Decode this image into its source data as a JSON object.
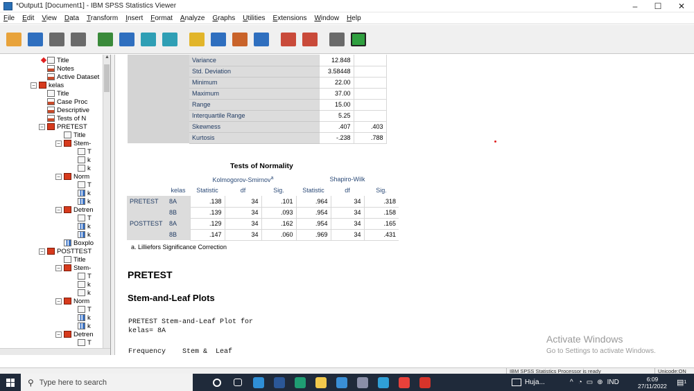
{
  "window": {
    "title": "*Output1 [Document1] - IBM SPSS Statistics Viewer",
    "controls": {
      "minimize": "–",
      "maximize": "☐",
      "close": "✕"
    }
  },
  "menu": [
    "File",
    "Edit",
    "View",
    "Data",
    "Transform",
    "Insert",
    "Format",
    "Analyze",
    "Graphs",
    "Utilities",
    "Extensions",
    "Window",
    "Help"
  ],
  "toolbar": {
    "icons": [
      "open-icon",
      "save-icon",
      "print-icon",
      "print-preview-icon",
      "export-icon",
      "recall-dialog-icon",
      "undo-icon",
      "redo-icon",
      "goto-data-icon",
      "goto-case-icon",
      "goto-variable-icon",
      "variables-icon",
      "show-all-icon",
      "designate-window-icon",
      "hide-icon",
      "show-icon"
    ],
    "colors": [
      "#e8a33b",
      "#2f6fbf",
      "#6a6a6a",
      "#6a6a6a",
      "#3a8a3a",
      "#2f6fbf",
      "#2f9fb5",
      "#2f9fb5",
      "#e2b52a",
      "#2f6fbf",
      "#c9632a",
      "#2f6fbf",
      "#c94a3a",
      "#c94a3a",
      "#6a6a6a",
      "#2f9f3f"
    ]
  },
  "tree": {
    "items": [
      {
        "label": "Title",
        "icon": "doc",
        "level": 4
      },
      {
        "label": "Notes",
        "icon": "tab",
        "level": 4
      },
      {
        "label": "Active Dataset",
        "icon": "tab",
        "level": 4
      },
      {
        "label": "kelas",
        "icon": "red",
        "level": 3
      },
      {
        "label": "Title",
        "icon": "doc",
        "level": 4
      },
      {
        "label": "Case Proc",
        "icon": "tab",
        "level": 4
      },
      {
        "label": "Descriptive",
        "icon": "tab",
        "level": 4
      },
      {
        "label": "Tests of N",
        "icon": "tab",
        "level": 4
      },
      {
        "label": "PRETEST",
        "icon": "red",
        "level": 4
      },
      {
        "label": "Title",
        "icon": "doc",
        "level": 5
      },
      {
        "label": "Stem-",
        "icon": "red",
        "level": 5
      },
      {
        "label": "T",
        "icon": "doc",
        "level": 6
      },
      {
        "label": "k",
        "icon": "doc",
        "level": 6
      },
      {
        "label": "k",
        "icon": "doc",
        "level": 6
      },
      {
        "label": "Norm",
        "icon": "red",
        "level": 5
      },
      {
        "label": "T",
        "icon": "doc",
        "level": 6
      },
      {
        "label": "k",
        "icon": "chart",
        "level": 6
      },
      {
        "label": "k",
        "icon": "chart",
        "level": 6
      },
      {
        "label": "Detren",
        "icon": "red",
        "level": 5
      },
      {
        "label": "T",
        "icon": "doc",
        "level": 6
      },
      {
        "label": "k",
        "icon": "chart",
        "level": 6
      },
      {
        "label": "k",
        "icon": "chart",
        "level": 6
      },
      {
        "label": "Boxplo",
        "icon": "chart",
        "level": 5
      },
      {
        "label": "POSTTEST",
        "icon": "red",
        "level": 4
      },
      {
        "label": "Title",
        "icon": "doc",
        "level": 5
      },
      {
        "label": "Stem-",
        "icon": "red",
        "level": 5
      },
      {
        "label": "T",
        "icon": "doc",
        "level": 6
      },
      {
        "label": "k",
        "icon": "doc",
        "level": 6
      },
      {
        "label": "k",
        "icon": "doc",
        "level": 6
      },
      {
        "label": "Norm",
        "icon": "red",
        "level": 5
      },
      {
        "label": "T",
        "icon": "doc",
        "level": 6
      },
      {
        "label": "k",
        "icon": "chart",
        "level": 6
      },
      {
        "label": "k",
        "icon": "chart",
        "level": 6
      },
      {
        "label": "Detren",
        "icon": "red",
        "level": 5
      },
      {
        "label": "T",
        "icon": "doc",
        "level": 6
      }
    ]
  },
  "descriptives": {
    "rows": [
      {
        "label": "Variance",
        "value": "12.848",
        "se": ""
      },
      {
        "label": "Std. Deviation",
        "value": "3.58448",
        "se": ""
      },
      {
        "label": "Minimum",
        "value": "22.00",
        "se": ""
      },
      {
        "label": "Maximum",
        "value": "37.00",
        "se": ""
      },
      {
        "label": "Range",
        "value": "15.00",
        "se": ""
      },
      {
        "label": "Interquartile Range",
        "value": "5.25",
        "se": ""
      },
      {
        "label": "Skewness",
        "value": ".407",
        "se": ".403"
      },
      {
        "label": "Kurtosis",
        "value": "-.238",
        "se": ".788"
      }
    ]
  },
  "normality": {
    "title": "Tests of Normality",
    "group_ks": "Kolmogorov-Smirnov",
    "group_ks_sup": "a",
    "group_sw": "Shapiro-Wilk",
    "col_kelas": "kelas",
    "cols": [
      "Statistic",
      "df",
      "Sig.",
      "Statistic",
      "df",
      "Sig."
    ],
    "rows": [
      {
        "var": "PRETEST",
        "kelas": "8A",
        "vals": [
          ".138",
          "34",
          ".101",
          ".964",
          "34",
          ".318"
        ]
      },
      {
        "var": "",
        "kelas": "8B",
        "vals": [
          ".139",
          "34",
          ".093",
          ".954",
          "34",
          ".158"
        ]
      },
      {
        "var": "POSTTEST",
        "kelas": "8A",
        "vals": [
          ".129",
          "34",
          ".162",
          ".954",
          "34",
          ".165"
        ]
      },
      {
        "var": "",
        "kelas": "8B",
        "vals": [
          ".147",
          "34",
          ".060",
          ".969",
          "34",
          ".431"
        ]
      }
    ],
    "footnote": "a. Lilliefors Significance Correction"
  },
  "sections": {
    "pretest_heading": "PRETEST",
    "stemleaf_heading": "Stem-and-Leaf Plots",
    "plot_line1": "PRETEST Stem-and-Leaf Plot for",
    "plot_line2": "kelas= 8A",
    "plot_header": "Frequency    Stem &  Leaf"
  },
  "watermark": {
    "title": "Activate Windows",
    "subtitle": "Go to Settings to activate Windows."
  },
  "status": {
    "processor": "IBM SPSS Statistics Processor is ready",
    "unicode": "Unicode:ON"
  },
  "taskbar": {
    "search_placeholder": "Type here to search",
    "apps": [
      "cortana-icon",
      "task-view-icon",
      "mail-icon",
      "word-icon",
      "edge-icon",
      "file-explorer-icon",
      "store-icon",
      "app-icon",
      "app-icon",
      "chrome-icon",
      "spss-icon"
    ],
    "app_colors": [
      "#ffffff",
      "#ffffff",
      "#2f8fd6",
      "#2b5797",
      "#1f9d73",
      "#f2c94c",
      "#3a8fd6",
      "#8a8fa8",
      "#2f9fd6",
      "#e8413a",
      "#d6342a"
    ],
    "tray_app": "Huja...",
    "lang": "IND",
    "time": "6:09",
    "date": "27/11/2022",
    "notif_count": "1"
  }
}
